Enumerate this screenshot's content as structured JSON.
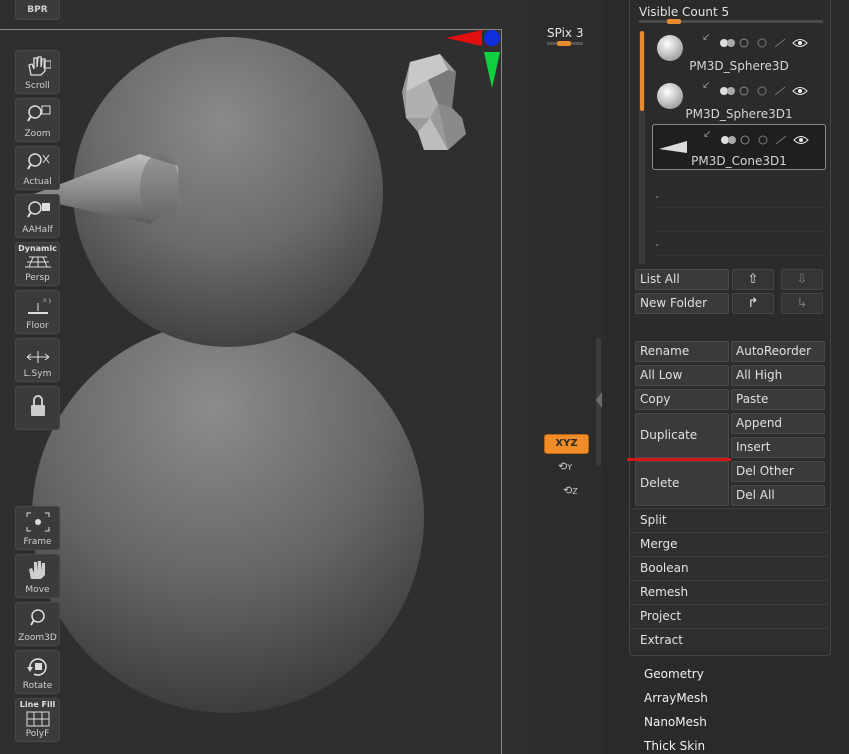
{
  "toolstrip": {
    "bpr": "BPR",
    "spix": "SPix 3",
    "buttons": [
      {
        "label": "Scroll",
        "icon": "hand-scroll-icon"
      },
      {
        "label": "Zoom",
        "icon": "zoom-magnifier-icon"
      },
      {
        "label": "Actual",
        "icon": "actual-size-icon"
      },
      {
        "label": "AAHalf",
        "icon": "aahalf-icon"
      },
      {
        "label": "Persp",
        "top": "Dynamic",
        "icon": "perspective-grid-icon"
      },
      {
        "label": "Floor",
        "icon": "floor-icon"
      },
      {
        "label": "L.Sym",
        "icon": "local-symmetry-icon"
      },
      {
        "label": "",
        "icon": "lock-icon"
      },
      {
        "label": "Frame",
        "icon": "frame-icon"
      },
      {
        "label": "Move",
        "icon": "move-hand-icon"
      },
      {
        "label": "Zoom3D",
        "icon": "zoom3d-icon"
      },
      {
        "label": "Rotate",
        "icon": "rotate-icon"
      },
      {
        "label": "PolyF",
        "top": "Line Fill",
        "icon": "polyframe-icon"
      }
    ],
    "xyz": "XYZ",
    "rot_y": "Y",
    "rot_z": "Z"
  },
  "subtool": {
    "visible_count_label": "Visible Count",
    "visible_count": "5",
    "items": [
      {
        "name": "PM3D_Sphere3D",
        "thumb": "sphere"
      },
      {
        "name": "PM3D_Sphere3D1",
        "thumb": "sphere"
      },
      {
        "name": "PM3D_Cone3D1",
        "thumb": "cone",
        "selected": true
      }
    ],
    "list_all": "List All",
    "new_folder": "New Folder",
    "actions": {
      "rename": "Rename",
      "auto_reorder": "AutoReorder",
      "all_low": "All Low",
      "all_high": "All High",
      "copy": "Copy",
      "paste": "Paste",
      "duplicate": "Duplicate",
      "append": "Append",
      "insert": "Insert",
      "delete": "Delete",
      "del_other": "Del Other",
      "del_all": "Del All"
    },
    "sections": [
      "Split",
      "Merge",
      "Boolean",
      "Remesh",
      "Project",
      "Extract"
    ]
  },
  "menus": [
    "Geometry",
    "ArrayMesh",
    "NanoMesh",
    "Thick Skin"
  ],
  "colors": {
    "accent": "#f28c28",
    "highlight_line": "#d01818",
    "axis_x": "#e01010",
    "axis_y": "#10d040",
    "axis_z": "#1030e0"
  }
}
